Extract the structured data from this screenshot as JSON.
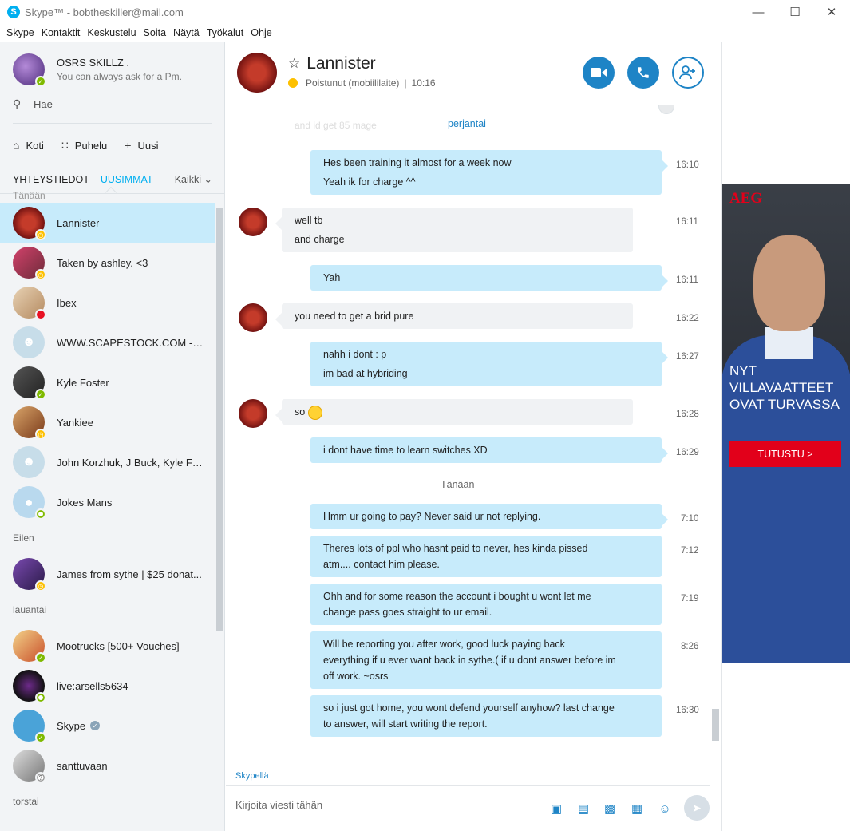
{
  "window": {
    "logo": "S",
    "title": "Skype™ - bobtheskiller@mail.com",
    "minimize_icon": "—",
    "maximize_icon": "☐",
    "close_icon": "✕"
  },
  "menu": [
    "Skype",
    "Kontaktit",
    "Keskustelu",
    "Soita",
    "Näytä",
    "Työkalut",
    "Ohje"
  ],
  "profile": {
    "name": "OSRS SKILLZ .",
    "mood": "You can always ask for a Pm."
  },
  "search": {
    "placeholder": "Hae"
  },
  "nav": {
    "home": "Koti",
    "call": "Puhelu",
    "new": "Uusi"
  },
  "tabs": {
    "contacts": "YHTEYSTIEDOT",
    "recent": "UUSIMMAT",
    "filter": "Kaikki"
  },
  "contact_groups": [
    {
      "label": "Tänään",
      "items": [
        {
          "name": "Lannister",
          "status": "away"
        },
        {
          "name": "Taken by ashley. <3",
          "status": "away"
        },
        {
          "name": "Ibex",
          "status": "busy"
        },
        {
          "name": "WWW.SCAPESTOCK.COM -RS...",
          "status": "group"
        },
        {
          "name": "Kyle Foster",
          "status": "online"
        },
        {
          "name": "Yankiee",
          "status": "away"
        },
        {
          "name": "John Korzhuk, J Buck, Kyle Fos...",
          "status": "group"
        },
        {
          "name": "Jokes Mans",
          "status": "offline"
        }
      ]
    },
    {
      "label": "Eilen",
      "items": [
        {
          "name": "James from sythe | $25 donat...",
          "status": "away"
        }
      ]
    },
    {
      "label": "lauantai",
      "items": [
        {
          "name": "Mootrucks [500+ Vouches]",
          "status": "online"
        },
        {
          "name": "live:arsells5634",
          "status": "offline"
        },
        {
          "name": "Skype",
          "status": "online"
        },
        {
          "name": "santtuvaan",
          "status": "unknown"
        }
      ]
    },
    {
      "label": "torstai",
      "items": []
    }
  ],
  "chat": {
    "name": "Lannister",
    "status": "Poistunut (mobiililaite)",
    "time": "10:16",
    "faded_text": "and id get 85 mage",
    "day_old": "perjantai",
    "day_today": "Tänään",
    "messages": [
      {
        "dir": "out",
        "lines": [
          "Hes been training it almost for a week now",
          "Yeah ik for charge ^^"
        ],
        "time": "16:10"
      },
      {
        "dir": "in",
        "lines": [
          "well tb",
          "and charge"
        ],
        "time": "16:11"
      },
      {
        "dir": "out",
        "lines": [
          "Yah"
        ],
        "time": "16:11"
      },
      {
        "dir": "in",
        "lines": [
          "you need to get a brid pure"
        ],
        "time": "16:22"
      },
      {
        "dir": "out",
        "lines": [
          "nahh i dont : p",
          "im bad at hybriding"
        ],
        "time": "16:27"
      },
      {
        "dir": "in",
        "lines": [
          "so"
        ],
        "time": "16:28",
        "emoji": "smiley-icon"
      },
      {
        "dir": "out",
        "lines": [
          "i dont have time to learn switches XD"
        ],
        "time": "16:29"
      },
      {
        "dir": "out",
        "lines": [
          "Hmm ur going to pay? Never said ur not replying."
        ],
        "time": "7:10"
      },
      {
        "dir": "out",
        "lines": [
          "Theres lots of ppl who hasnt paid to never, hes kinda pissed",
          "atm.... contact him please."
        ],
        "time": "7:12"
      },
      {
        "dir": "out",
        "lines": [
          "Ohh and for some reason the account i bought u wont let me",
          "change pass goes straight to ur email."
        ],
        "time": "7:19"
      },
      {
        "dir": "out",
        "lines": [
          "Will be reporting you after work, good luck paying back",
          "everything if u ever want back in sythe.( if u dont answer before im",
          "off work. ~osrs"
        ],
        "time": "8:26"
      },
      {
        "dir": "out",
        "lines": [
          "so i just got home, you wont defend yourself anyhow? last change",
          "to answer, will start writing the report."
        ],
        "time": "16:30"
      }
    ],
    "compose_label": "Skypellä",
    "compose_placeholder": "Kirjoita viesti tähän"
  },
  "ad": {
    "brand": "AEG",
    "headline": [
      "NYT",
      "VILLAVAATTEET",
      "OVAT TURVASSA"
    ],
    "cta": "TUTUSTU >"
  },
  "colors": {
    "accent": "#00aff0",
    "button_blue": "#1e84c6",
    "bubble_out": "#c7ebfb",
    "bubble_in": "#f0f2f4",
    "online": "#7fba00",
    "away": "#fdc000",
    "busy": "#e81123",
    "ad_red": "#e2001a"
  }
}
